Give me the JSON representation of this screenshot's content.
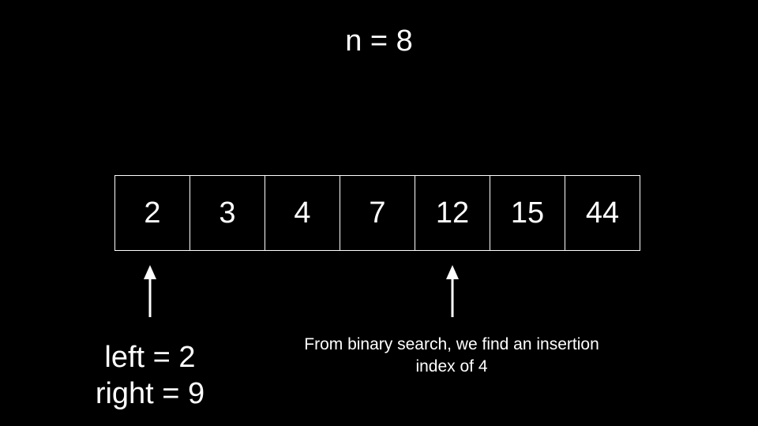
{
  "title": "n = 8",
  "array": {
    "cells": [
      "2",
      "3",
      "4",
      "7",
      "12",
      "15",
      "44"
    ]
  },
  "pointers": {
    "left_label": "left = 2",
    "right_label": "right = 9"
  },
  "note": {
    "line1": "From binary search, we find an insertion",
    "line2": "index of 4"
  },
  "colors": {
    "background": "#000000",
    "foreground": "#ffffff"
  }
}
